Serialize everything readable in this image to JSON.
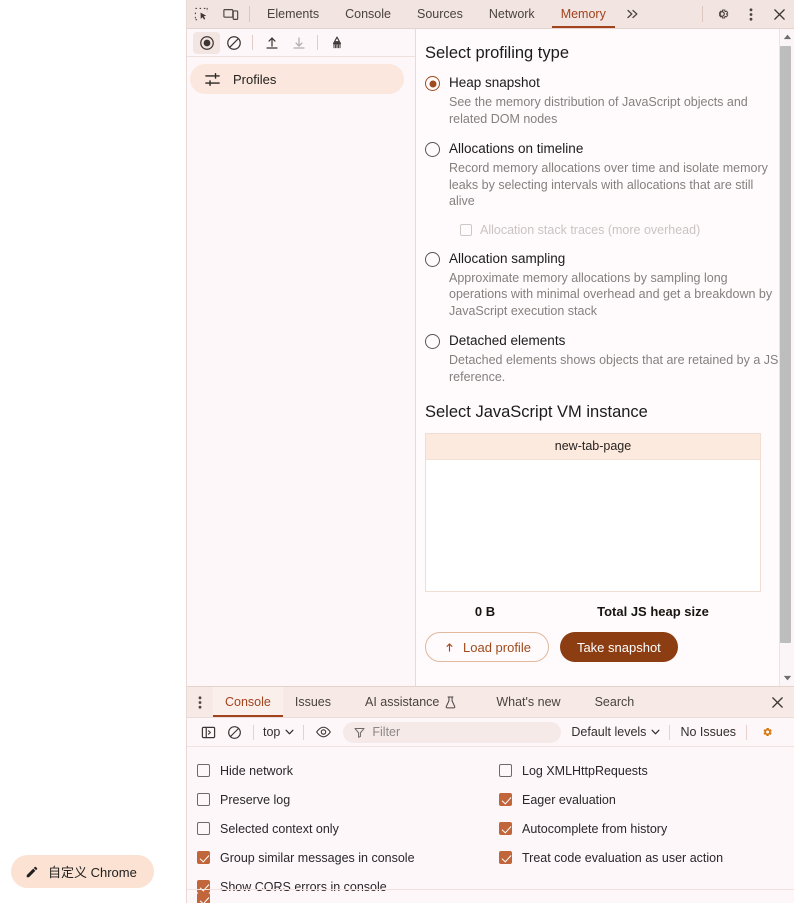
{
  "browser_page": {
    "customize_button": {
      "label": "自定义 Chrome",
      "icon": "pencil-icon"
    }
  },
  "devtools": {
    "tabbar": {
      "inspect_icon": "inspect-element-icon",
      "device_icon": "device-toolbar-icon",
      "tabs": [
        {
          "label": "Elements",
          "active": false
        },
        {
          "label": "Console",
          "active": false
        },
        {
          "label": "Sources",
          "active": false
        },
        {
          "label": "Network",
          "active": false
        },
        {
          "label": "Memory",
          "active": true
        }
      ],
      "more_tabs_icon": "chevron-double-right-icon",
      "settings_icon": "gear-icon",
      "menu_icon": "kebab-menu-icon",
      "close_icon": "close-icon",
      "accent_color": "#a1431d"
    },
    "memory_toolbar": {
      "record_icon": "record-icon",
      "clear_icon": "clear-icon",
      "load_icon": "upload-icon",
      "save_icon": "download-icon",
      "gc_icon": "collect-garbage-icon"
    },
    "sidebar": {
      "items": [
        {
          "label": "Profiles",
          "icon": "sliders-icon",
          "selected": true
        }
      ]
    },
    "profiling": {
      "section_title": "Select profiling type",
      "options": [
        {
          "title": "Heap snapshot",
          "desc": "See the memory distribution of JavaScript objects and related DOM nodes",
          "checked": true
        },
        {
          "title": "Allocations on timeline",
          "desc": "Record memory allocations over time and isolate memory leaks by selecting intervals with allocations that are still alive",
          "checked": false,
          "sub_checkbox": {
            "label": "Allocation stack traces (more overhead)",
            "checked": false,
            "disabled": true
          }
        },
        {
          "title": "Allocation sampling",
          "desc": "Approximate memory allocations by sampling long operations with minimal overhead and get a breakdown by JavaScript execution stack",
          "checked": false
        },
        {
          "title": "Detached elements",
          "desc": "Detached elements shows objects that are retained by a JS reference.",
          "checked": false
        }
      ]
    },
    "vm_instance": {
      "section_title": "Select JavaScript VM instance",
      "column_header": "new-tab-page",
      "heap_value": "0 B",
      "heap_label": "Total JS heap size"
    },
    "memory_buttons": {
      "load_profile": {
        "label": "Load profile",
        "icon": "upload-icon"
      },
      "take_snapshot": {
        "label": "Take snapshot"
      }
    },
    "scrollbar": {
      "up_icon": "scroll-up-icon",
      "down_icon": "scroll-down-icon"
    }
  },
  "drawer": {
    "menu_icon": "kebab-menu-icon",
    "tabs": [
      {
        "label": "Console",
        "active": true,
        "icon": null
      },
      {
        "label": "Issues",
        "active": false,
        "icon": null
      },
      {
        "label": "AI assistance",
        "active": false,
        "icon": "flask-icon"
      },
      {
        "label": "What's new",
        "active": false,
        "icon": null
      },
      {
        "label": "Search",
        "active": false,
        "icon": null
      }
    ],
    "close_icon": "close-icon",
    "console_toolbar": {
      "sidebar_icon": "console-sidebar-icon",
      "clear_icon": "clear-console-icon",
      "context": "top",
      "context_caret": "chevron-down-icon",
      "eye_icon": "live-expression-icon",
      "filter_icon": "filter-icon",
      "filter_placeholder": "Filter",
      "filter_value": "",
      "levels": "Default levels",
      "levels_caret": "chevron-down-icon",
      "issues": "No Issues",
      "settings_icon": "gear-icon",
      "settings_active_color": "#d4770c"
    },
    "console_settings": {
      "left_column": [
        {
          "label": "Hide network",
          "checked": false
        },
        {
          "label": "Preserve log",
          "checked": false
        },
        {
          "label": "Selected context only",
          "checked": false
        },
        {
          "label": "Group similar messages in console",
          "checked": true
        },
        {
          "label": "Show CORS errors in console",
          "checked": true
        }
      ],
      "right_column": [
        {
          "label": "Log XMLHttpRequests",
          "checked": false
        },
        {
          "label": "Eager evaluation",
          "checked": true
        },
        {
          "label": "Autocomplete from history",
          "checked": true
        },
        {
          "label": "Treat code evaluation as user action",
          "checked": true
        }
      ]
    }
  }
}
